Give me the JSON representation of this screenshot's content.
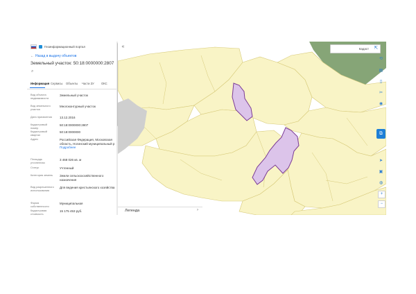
{
  "header": {
    "portal_name": "Геоинформационный портал"
  },
  "back_link": "Назад в выдачу объектов",
  "parcel_title": "Земельный участок: 50:18:0000000:2807",
  "search_icon": "search-icon",
  "tabs": [
    {
      "label": "Информация",
      "active": true
    },
    {
      "label": "Сервисы",
      "active": false
    },
    {
      "label": "Объекты",
      "active": false
    },
    {
      "label": "Части ЗУ",
      "active": false
    },
    {
      "label": "ОКС",
      "active": false
    }
  ],
  "info": [
    {
      "label": "Вид объекта недвижимости",
      "value": "Земельный участок"
    },
    {
      "label": "Вид земельного участка",
      "value": "Многоконтурный участок"
    },
    {
      "label": "Дата присвоения",
      "value": "13.12.2016"
    },
    {
      "label": "Кадастровый номер",
      "value": "50:18:0000000:2807"
    },
    {
      "label": "Кадастровый квартал",
      "value": "50:18:0000000"
    },
    {
      "label": "Адрес",
      "value": "Российская Федерация, Московская область, Ногинский муниципальный р",
      "link": "Подробнее"
    },
    {
      "label": "Площадь уточненная",
      "value": "3 468 026 кв. м"
    },
    {
      "label": "Статус",
      "value": "Учтенный"
    },
    {
      "label": "Категория земель",
      "value": "Земли сельскохозяйственного назначения"
    },
    {
      "label": "Вид разрешенного использования",
      "value": "Для ведения крестьянского хозяйства"
    },
    {
      "label": "Форма собственности",
      "value": "Муниципальная"
    },
    {
      "label": "Кадастровая стоимость",
      "value": "15 175 453 руб."
    }
  ],
  "map": {
    "search_value": "Кадаст",
    "clear_icon": "close-icon",
    "collapse_icon": "chevron-left-icon",
    "legend_label": "Легенда",
    "legend_icon": "chevron-right-icon",
    "chat_icon": "chat-icon",
    "tools_top": [
      "layers-icon",
      "ruler-icon",
      "document-icon",
      "scissors-icon",
      "globe-icon"
    ],
    "tools_bottom": [
      "location-icon",
      "image-icon",
      "info-icon",
      "zoom-in-icon",
      "zoom-out-icon"
    ],
    "colors": {
      "parcels_fill": "#f9f4c6",
      "parcels_stroke": "#d6c978",
      "highlight_fill": "#dcc4ea",
      "highlight_stroke": "#7a3a95",
      "forest": "#86a577",
      "road": "#cfcfcf"
    }
  }
}
